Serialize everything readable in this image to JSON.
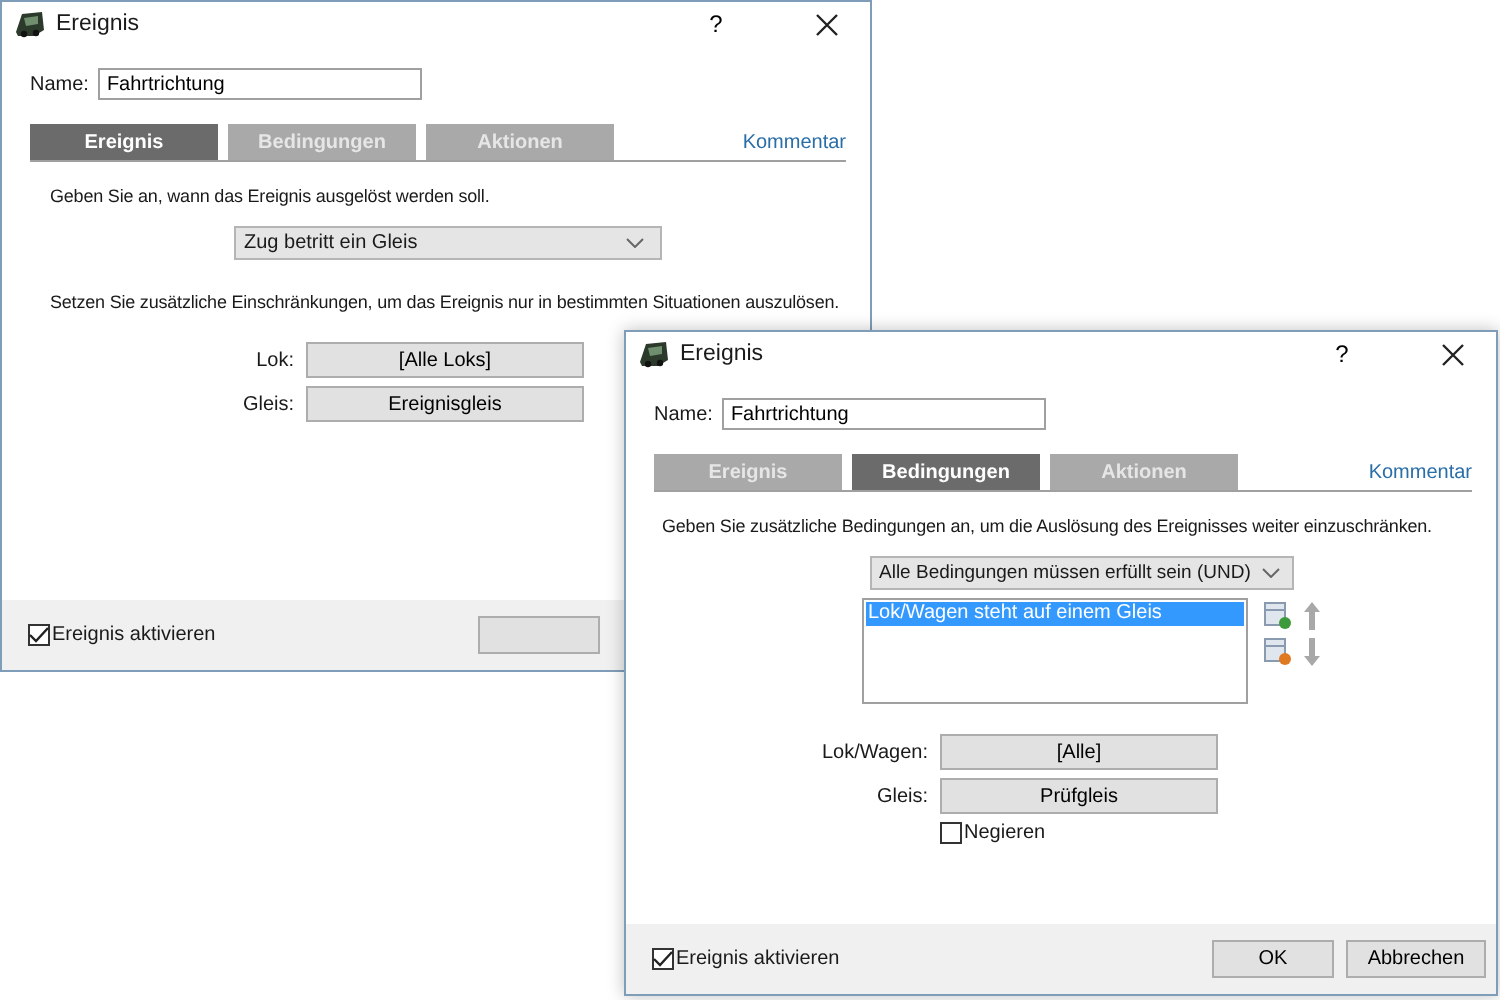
{
  "windows": [
    {
      "title": "Ereignis",
      "help": "?",
      "name_label": "Name:",
      "name_value": "Fahrtrichtung",
      "tabs": [
        {
          "label": "Ereignis",
          "selected": true
        },
        {
          "label": "Bedingungen",
          "selected": false
        },
        {
          "label": "Aktionen",
          "selected": false
        }
      ],
      "comment_link": "Kommentar",
      "description": "Geben Sie an, wann das Ereignis ausgelöst werden soll.",
      "dropdown": "Zug betritt ein Gleis",
      "description_2": "Setzen Sie zusätzliche Einschränkungen, um das Ereignis nur in bestimmten Situationen auszulösen.",
      "fields": [
        {
          "label": "Lok:",
          "value": "[Alle Loks]"
        },
        {
          "label": "Gleis:",
          "value": "Ereignisgleis"
        }
      ],
      "activate": {
        "label": "Ereignis aktivieren",
        "checked": true
      },
      "footer_buttons": [
        {
          "kind": "covered"
        }
      ]
    },
    {
      "title": "Ereignis",
      "help": "?",
      "name_label": "Name:",
      "name_value": "Fahrtrichtung",
      "tabs": [
        {
          "label": "Ereignis",
          "selected": false
        },
        {
          "label": "Bedingungen",
          "selected": true
        },
        {
          "label": "Aktionen",
          "selected": false
        }
      ],
      "comment_link": "Kommentar",
      "description": "Geben Sie zusätzliche Bedingungen an, um die Auslösung des Ereignisses weiter einzuschränken.",
      "dropdown": "Alle Bedingungen müssen erfüllt sein (UND)",
      "conditions": [
        {
          "label": "Lok/Wagen steht auf einem Gleis",
          "selected": true
        }
      ],
      "fields": [
        {
          "label": "Lok/Wagen:",
          "value": "[Alle]"
        },
        {
          "label": "Gleis:",
          "value": "Prüfgleis"
        }
      ],
      "negate": {
        "label": "Negieren",
        "checked": false
      },
      "activate": {
        "label": "Ereignis aktivieren",
        "checked": true
      },
      "footer_buttons": [
        {
          "kind": "text",
          "label": "OK"
        },
        {
          "kind": "text",
          "label": "Abbrechen"
        }
      ]
    }
  ]
}
